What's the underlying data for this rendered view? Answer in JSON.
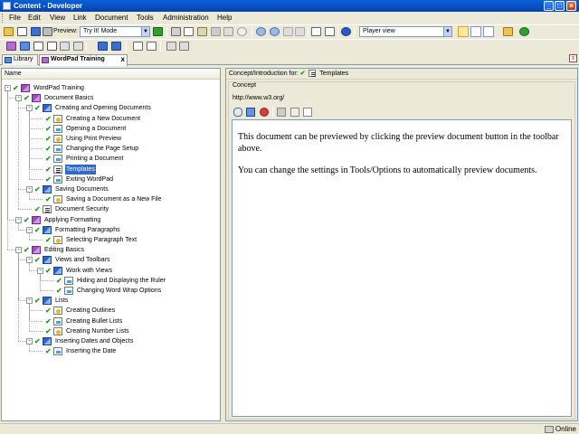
{
  "window": {
    "title": "Content - Developer",
    "minimize": "_",
    "maximize": "□",
    "close": "×"
  },
  "menu": [
    "File",
    "Edit",
    "View",
    "Link",
    "Document",
    "Tools",
    "Administration",
    "Help"
  ],
  "toolbar": {
    "preview_label": "Preview:",
    "mode_value": "Try It! Mode",
    "view_value": "Player view"
  },
  "tabs": [
    {
      "label": "Library",
      "icon": "library-icon"
    },
    {
      "label": "WordPad Training",
      "icon": "course-icon",
      "close": "x"
    }
  ],
  "tab_close_all": "x",
  "tree": {
    "column_header": "Name",
    "selected_item": "Templates",
    "nodes": [
      {
        "label": "WordPad Training",
        "level": 0,
        "icon": "course",
        "checked": true,
        "expander": "-"
      },
      {
        "label": "Document Basics",
        "level": 1,
        "icon": "course",
        "checked": true,
        "expander": "-"
      },
      {
        "label": "Creating and Opening Documents",
        "level": 2,
        "icon": "group",
        "checked": true,
        "expander": "-"
      },
      {
        "label": "Creating a New Document",
        "level": 3,
        "icon": "warn",
        "checked": true
      },
      {
        "label": "Opening a Document",
        "level": 3,
        "icon": "page",
        "checked": true
      },
      {
        "label": "Using Print Preview",
        "level": 3,
        "icon": "warn",
        "checked": true
      },
      {
        "label": "Changing the Page Setup",
        "level": 3,
        "icon": "page",
        "checked": true
      },
      {
        "label": "Printing a Document",
        "level": 3,
        "icon": "page",
        "checked": true
      },
      {
        "label": "Templates",
        "level": 3,
        "icon": "doclist",
        "checked": true,
        "selected": true
      },
      {
        "label": "Exiting WordPad",
        "level": 3,
        "icon": "page",
        "checked": true
      },
      {
        "label": "Saving Documents",
        "level": 2,
        "icon": "group",
        "checked": true,
        "expander": "-"
      },
      {
        "label": "Saving a Document as a New File",
        "level": 3,
        "icon": "warn",
        "checked": true
      },
      {
        "label": "Document Security",
        "level": 2,
        "icon": "doclist",
        "checked": true
      },
      {
        "label": "Applying Formatting",
        "level": 1,
        "icon": "course",
        "checked": true,
        "expander": "-"
      },
      {
        "label": "Formatting Paragraphs",
        "level": 2,
        "icon": "group",
        "checked": true,
        "expander": "-"
      },
      {
        "label": "Selecting Paragraph Text",
        "level": 3,
        "icon": "warn",
        "checked": true
      },
      {
        "label": "Editing Basics",
        "level": 1,
        "icon": "course",
        "checked": true,
        "expander": "-"
      },
      {
        "label": "Views and Toolbars",
        "level": 2,
        "icon": "group",
        "checked": true,
        "expander": "-"
      },
      {
        "label": "Work with Views",
        "level": 3,
        "icon": "group",
        "checked": true,
        "expander": "-"
      },
      {
        "label": "Hiding and Displaying the Ruler",
        "level": 4,
        "icon": "page",
        "checked": true
      },
      {
        "label": "Changing Word Wrap Options",
        "level": 4,
        "icon": "page",
        "checked": true
      },
      {
        "label": "Lists",
        "level": 2,
        "icon": "group",
        "checked": true,
        "expander": "-"
      },
      {
        "label": "Creating Outlines",
        "level": 3,
        "icon": "warn",
        "checked": true
      },
      {
        "label": "Creating Bullet Lists",
        "level": 3,
        "icon": "page",
        "checked": true
      },
      {
        "label": "Creating Number Lists",
        "level": 3,
        "icon": "warn",
        "checked": true
      },
      {
        "label": "Inserting Dates and Objects",
        "level": 2,
        "icon": "group",
        "checked": true,
        "expander": "-"
      },
      {
        "label": "Inserting the Date",
        "level": 3,
        "icon": "page",
        "checked": true
      }
    ]
  },
  "concept_panel": {
    "header_prefix": "Concept/Introduction for:",
    "header_item": "Templates",
    "check": "✔",
    "legend": "Concept",
    "url": "http://www.w3.org/",
    "paragraphs": [
      "This document can be previewed by clicking the preview document button in the toolbar above.",
      "You can change the settings in Tools/Options to automatically preview documents."
    ]
  },
  "status": {
    "online": "Online"
  },
  "colors": {
    "title_bar": "#0a5fd8",
    "selection": "#316ac5",
    "check": "#1fa31f"
  }
}
